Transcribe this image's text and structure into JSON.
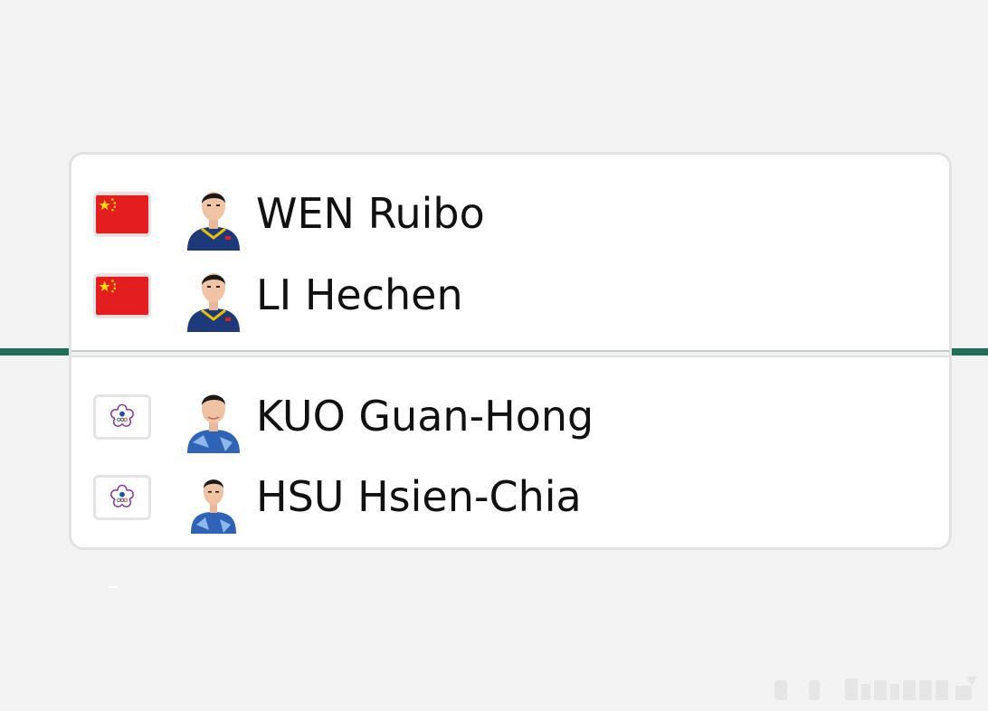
{
  "team_a": {
    "flag_icon": "china-flag-icon",
    "flag_color": "#e41e1e",
    "players": [
      {
        "name": "WEN Ruibo",
        "avatar_icon": "player-photo-icon"
      },
      {
        "name": "LI Hechen",
        "avatar_icon": "player-photo-icon"
      }
    ]
  },
  "team_b": {
    "flag_icon": "chinese-taipei-flag-icon",
    "players": [
      {
        "name": "KUO Guan-Hong",
        "avatar_icon": "player-photo-icon"
      },
      {
        "name": "HSU Hsien-Chia",
        "avatar_icon": "player-photo-icon"
      }
    ]
  },
  "accent_color": "#1f6e57"
}
